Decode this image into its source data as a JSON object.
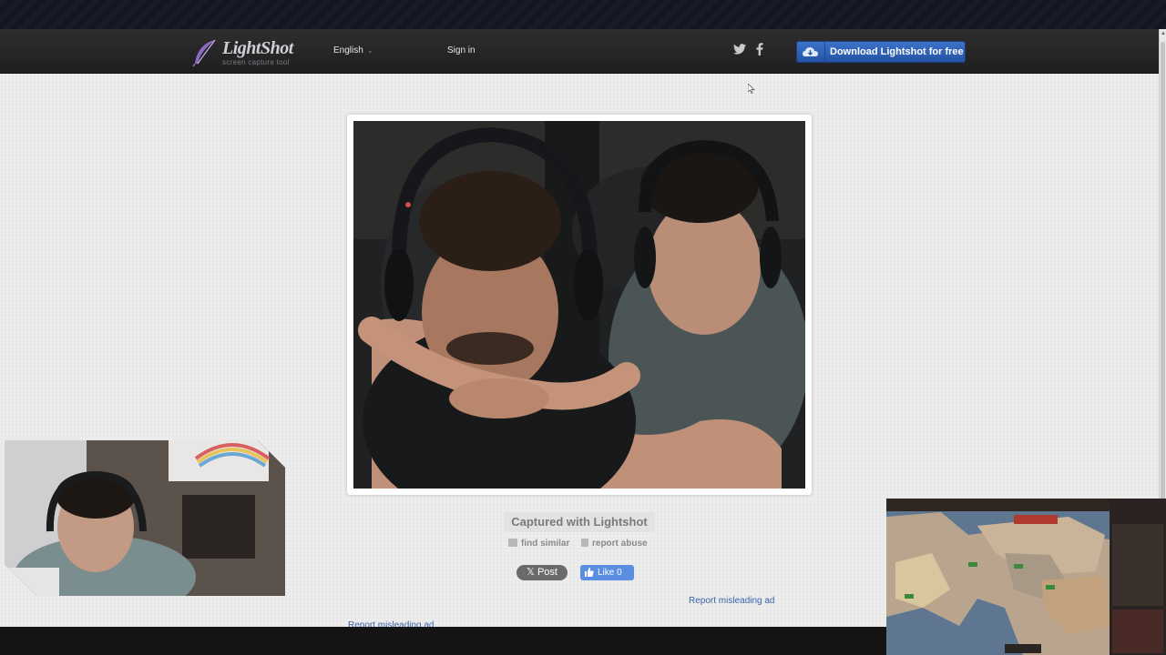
{
  "header": {
    "logo_name": "LightShot",
    "logo_tagline": "screen capture tool",
    "language": "English",
    "sign_in": "Sign in",
    "social_twitter": "twitter-icon",
    "social_facebook": "facebook-icon",
    "download_label": "Download Lightshot for free"
  },
  "main": {
    "captured_label": "Captured with Lightshot",
    "find_similar": "find similar",
    "report_abuse": "report abuse",
    "post_label": "Post",
    "like_label": "Like",
    "like_count": "0",
    "report_ad": "Report misleading ad",
    "report_ad_second": "Report misleading ad"
  },
  "colors": {
    "download_button": "#2d61b8",
    "page_background": "#ececec",
    "header_background": "#262626"
  }
}
